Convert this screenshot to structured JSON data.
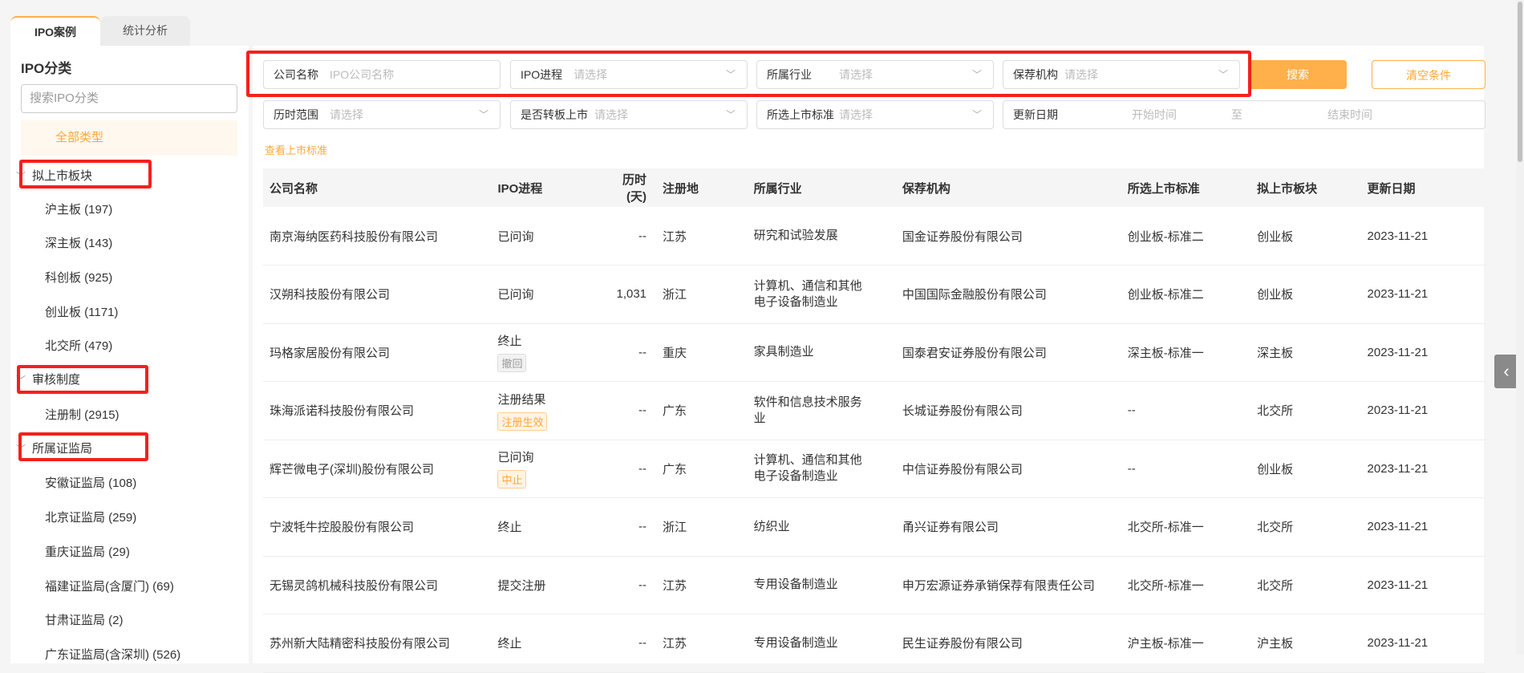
{
  "tabs": [
    "IPO案例",
    "统计分析"
  ],
  "sidebar": {
    "title": "IPO分类",
    "search_placeholder": "搜索IPO分类",
    "all_label": "全部类型",
    "groups": [
      {
        "label": "拟上市板块",
        "items": [
          "沪主板 (197)",
          "深主板 (143)",
          "科创板 (925)",
          "创业板 (1171)",
          "北交所 (479)"
        ]
      },
      {
        "label": "审核制度",
        "items": [
          "注册制 (2915)"
        ]
      },
      {
        "label": "所属证监局",
        "items": [
          "安徽证监局 (108)",
          "北京证监局 (259)",
          "重庆证监局 (29)",
          "福建证监局(含厦门) (69)",
          "甘肃证监局 (2)",
          "广东证监局(含深圳) (526)"
        ]
      }
    ]
  },
  "filters": {
    "company": {
      "label": "公司名称",
      "placeholder": "IPO公司名称"
    },
    "progress": {
      "label": "IPO进程",
      "placeholder": "请选择"
    },
    "industry": {
      "label": "所属行业",
      "placeholder": "请选择"
    },
    "sponsor": {
      "label": "保荐机构",
      "placeholder": "请选择"
    },
    "duration": {
      "label": "历时范围",
      "placeholder": "请选择"
    },
    "transfer": {
      "label": "是否转板上市",
      "placeholder": "请选择"
    },
    "standard": {
      "label": "所选上市标准",
      "placeholder": "请选择"
    },
    "date": {
      "label": "更新日期",
      "start": "开始时间",
      "sep": "至",
      "end": "结束时间"
    },
    "search_button": "搜索",
    "clear_button": "清空条件",
    "standards_link": "查看上市标准"
  },
  "table": {
    "headers": [
      "公司名称",
      "IPO进程",
      "历时(天)",
      "注册地",
      "所属行业",
      "保荐机构",
      "所选上市标准",
      "拟上市板块",
      "更新日期"
    ],
    "rows": [
      {
        "name": "南京海纳医药科技股份有限公司",
        "progress": "已问询",
        "tag": "",
        "days": "--",
        "region": "江苏",
        "industry": "研究和试验发展",
        "sponsor": "国金证券股份有限公司",
        "standard": "创业板-标准二",
        "board": "创业板",
        "date": "2023-11-21"
      },
      {
        "name": "汉朔科技股份有限公司",
        "progress": "已问询",
        "tag": "",
        "days": "1,031",
        "region": "浙江",
        "industry": "计算机、通信和其他电子设备制造业",
        "sponsor": "中国国际金融股份有限公司",
        "standard": "创业板-标准二",
        "board": "创业板",
        "date": "2023-11-21"
      },
      {
        "name": "玛格家居股份有限公司",
        "progress": "终止",
        "tag": "撤回",
        "days": "--",
        "region": "重庆",
        "industry": "家具制造业",
        "sponsor": "国泰君安证券股份有限公司",
        "standard": "深主板-标准一",
        "board": "深主板",
        "date": "2023-11-21"
      },
      {
        "name": "珠海派诺科技股份有限公司",
        "progress": "注册结果",
        "tag": "注册生效",
        "days": "--",
        "region": "广东",
        "industry": "软件和信息技术服务业",
        "sponsor": "长城证券股份有限公司",
        "standard": "--",
        "board": "北交所",
        "date": "2023-11-21"
      },
      {
        "name": "辉芒微电子(深圳)股份有限公司",
        "progress": "已问询",
        "tag": "中止",
        "days": "--",
        "region": "广东",
        "industry": "计算机、通信和其他电子设备制造业",
        "sponsor": "中信证券股份有限公司",
        "standard": "--",
        "board": "创业板",
        "date": "2023-11-21"
      },
      {
        "name": "宁波牦牛控股股份有限公司",
        "progress": "终止",
        "tag": "",
        "days": "--",
        "region": "浙江",
        "industry": "纺织业",
        "sponsor": "甬兴证券有限公司",
        "standard": "北交所-标准一",
        "board": "北交所",
        "date": "2023-11-21"
      },
      {
        "name": "无锡灵鸽机械科技股份有限公司",
        "progress": "提交注册",
        "tag": "",
        "days": "--",
        "region": "江苏",
        "industry": "专用设备制造业",
        "sponsor": "申万宏源证券承销保荐有限责任公司",
        "standard": "北交所-标准一",
        "board": "北交所",
        "date": "2023-11-21"
      },
      {
        "name": "苏州新大陆精密科技股份有限公司",
        "progress": "终止",
        "tag": "",
        "days": "--",
        "region": "江苏",
        "industry": "专用设备制造业",
        "sponsor": "民生证券股份有限公司",
        "standard": "沪主板-标准一",
        "board": "沪主板",
        "date": "2023-11-21"
      }
    ]
  },
  "colors": {
    "accent": "#ffb04a",
    "highlight": "#f5201b"
  }
}
